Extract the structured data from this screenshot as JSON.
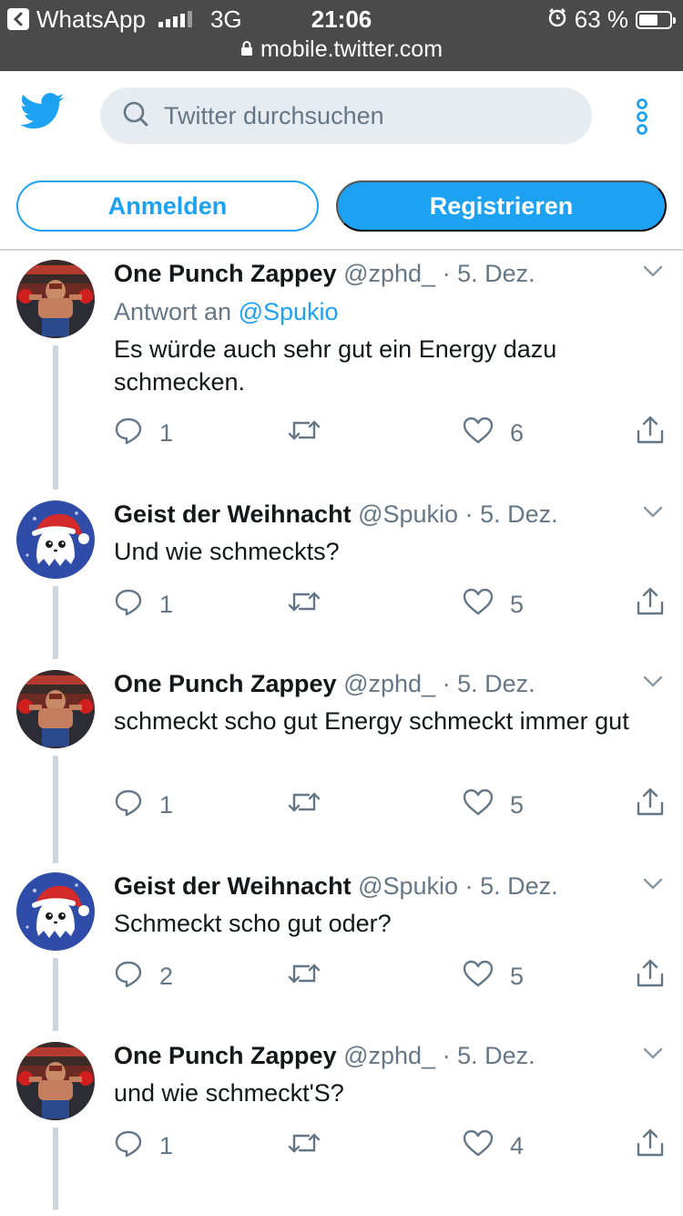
{
  "status_bar": {
    "back_app": "WhatsApp",
    "network": "3G",
    "time": "21:06",
    "battery_percent": "63 %",
    "battery_level": 0.63,
    "url": "mobile.twitter.com"
  },
  "header": {
    "search_placeholder": "Twitter durchsuchen"
  },
  "auth": {
    "login_label": "Anmelden",
    "register_label": "Registrieren"
  },
  "colors": {
    "accent": "#1da1f2",
    "muted": "#657786",
    "text": "#14171a"
  },
  "tweets": [
    {
      "name": "One Punch Zappey",
      "handle": "@zphd_",
      "sep": "·",
      "date": "5. Dez.",
      "reply_prefix": "Antwort an",
      "reply_mention": "@Spukio",
      "text": "Es würde auch sehr gut ein Energy dazu schmecken.",
      "replies": "1",
      "retweets": "",
      "likes": "6",
      "avatar": "boxer-avatar"
    },
    {
      "name": "Geist der Weihnacht",
      "handle": "@Spukio",
      "sep": "·",
      "date": "5. Dez.",
      "text": "Und wie schmeckts?",
      "replies": "1",
      "retweets": "",
      "likes": "5",
      "avatar": "ghost-santa-avatar"
    },
    {
      "name": "One Punch Zappey",
      "handle": "@zphd_",
      "sep": "·",
      "date": "5. Dez.",
      "text": "schmeckt scho gut Energy schmeckt immer gut",
      "replies": "1",
      "retweets": "",
      "likes": "5",
      "avatar": "boxer-avatar"
    },
    {
      "name": "Geist der Weihnacht",
      "handle": "@Spukio",
      "sep": "·",
      "date": "5. Dez.",
      "text": "Schmeckt scho gut oder?",
      "replies": "2",
      "retweets": "",
      "likes": "5",
      "avatar": "ghost-santa-avatar"
    },
    {
      "name": "One Punch Zappey",
      "handle": "@zphd_",
      "sep": "·",
      "date": "5. Dez.",
      "text": "und wie schmeckt'S?",
      "replies": "1",
      "retweets": "",
      "likes": "4",
      "avatar": "boxer-avatar"
    }
  ]
}
